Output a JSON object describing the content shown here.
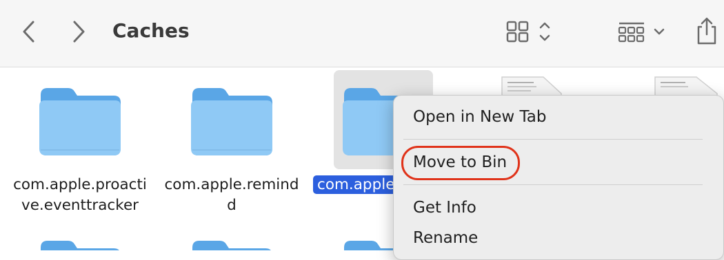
{
  "toolbar": {
    "title": "Caches",
    "back_icon": "chevron-left-icon",
    "forward_icon": "chevron-right-icon",
    "view_icon": "icon-grid-view-icon",
    "group_icon": "group-by-icon",
    "share_icon": "share-icon"
  },
  "files": [
    {
      "name": "com.apple.proacti\nve.eventtracker",
      "line1": "com.apple.proacti",
      "line2": "ve.eventtracker",
      "kind": "folder"
    },
    {
      "name": "com.apple.remind\nd",
      "line1": "com.apple.remind",
      "line2": "d",
      "kind": "folder"
    },
    {
      "name": "com.apple",
      "line1": "com.apple",
      "kind": "folder",
      "selected": true
    }
  ],
  "context_menu": {
    "items": [
      {
        "label": "Open in New Tab"
      },
      {
        "label": "Move to Bin",
        "highlighted": true
      },
      {
        "label": "Get Info"
      },
      {
        "label": "Rename"
      }
    ]
  },
  "colors": {
    "folder_light": "#8fc9f5",
    "folder_dark": "#5aa6e6",
    "selection": "#2c5fde",
    "highlight_ring": "#e0331a"
  }
}
